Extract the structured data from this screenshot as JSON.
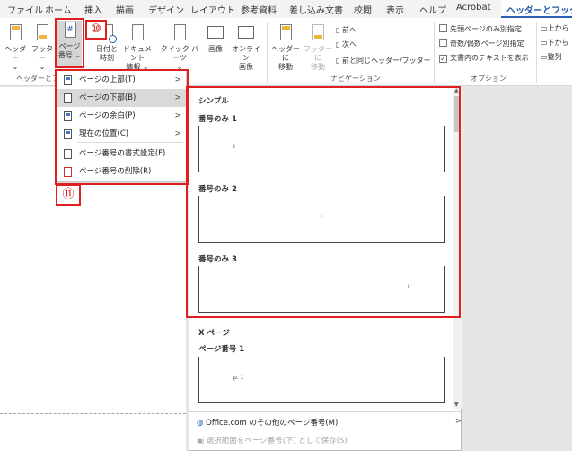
{
  "tabs": [
    "ファイル",
    "ホーム",
    "挿入",
    "描画",
    "デザイン",
    "レイアウト",
    "参考資料",
    "差し込み文書",
    "校閲",
    "表示",
    "ヘルプ",
    "Acrobat",
    "ヘッダーとフッター"
  ],
  "ribbon": {
    "header_label": "ヘッダー",
    "footer_label": "フッター",
    "page_number_label": [
      "ページ",
      "番号"
    ],
    "date_time_label": [
      "日付と",
      "時刻"
    ],
    "doc_info_label": [
      "ドキュメント",
      "情報"
    ],
    "quick_parts_label": "クイック パーツ",
    "picture_label": "画像",
    "online_picture_label": [
      "オンライン",
      "画像"
    ],
    "goto_header_label": [
      "ヘッダーに",
      "移動"
    ],
    "goto_footer_label": [
      "フッターに",
      "移動"
    ],
    "prev_label": "前へ",
    "next_label": "次へ",
    "link_prev_label": "前と同じヘッダー/フッター",
    "opt_first_page": "先頭ページのみ別指定",
    "opt_odd_even": "奇数/偶数ページ別指定",
    "opt_show_text": "文書内のテキストを表示",
    "opt_show_text_checked": true,
    "right_top": "上から",
    "right_bottom": "下から",
    "right_align": "整列",
    "group_hf": "ヘッダーとフッ",
    "group_nav": "ナビゲーション",
    "group_opt": "オプション"
  },
  "menu": {
    "items": [
      {
        "label": "ページの上部(T)",
        "arrow": true,
        "highlighted": false
      },
      {
        "label": "ページの下部(B)",
        "arrow": true,
        "highlighted": true
      },
      {
        "label": "ページの余白(P)",
        "arrow": true,
        "highlighted": false
      },
      {
        "label": "現在の位置(C)",
        "arrow": true,
        "highlighted": false
      },
      {
        "label": "ページ番号の書式設定(F)...",
        "arrow": false,
        "highlighted": false
      },
      {
        "label": "ページ番号の削除(R)",
        "arrow": false,
        "highlighted": false
      }
    ]
  },
  "gallery": {
    "section1": "シンプル",
    "items1": [
      "番号のみ 1",
      "番号のみ 2",
      "番号のみ 3"
    ],
    "section2": "X ページ",
    "items2": [
      "ページ番号 1"
    ],
    "thumb_pn": "I",
    "thumb_pn2": "p. 1",
    "more_label": "Office.com のその他のページ番号(M)",
    "save_label": "選択範囲をページ番号(下) として保存(S)"
  },
  "annotations": {
    "badge10": "⑩",
    "badge11": "⑪"
  },
  "colors": {
    "accent": "#2b5fb3",
    "annotation": "#e02020"
  }
}
